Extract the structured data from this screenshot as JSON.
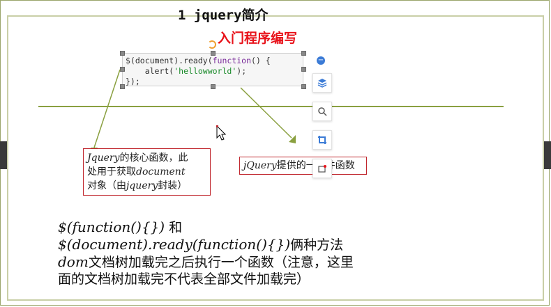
{
  "slide": {
    "title": "1 jquery简介",
    "subtitle": "入门程序编写",
    "code": {
      "line1_a": "$(document).ready(",
      "line1_kw": "function",
      "line1_b": "() {",
      "line2_a": "    alert(",
      "line2_str": "'hellowworld'",
      "line2_b": ");",
      "line3": "});"
    },
    "note1": {
      "part1": "Jquery",
      "part2": "的核心函数，此",
      "part3": "处用于获取",
      "part4": "document",
      "part5": "对象（由",
      "part6": "jquery",
      "part7": "封装）"
    },
    "note2": {
      "part1": "jQuery",
      "part2": "提供的一个件函数"
    },
    "body": {
      "l1_a": "$(function(){})",
      "l1_b": " 和",
      "l2_a": "$(document).ready(function(){})",
      "l2_b": "俩种方法",
      "l3_a": "dom",
      "l3_b": "文档树加载完之后执行一个函数（注意，这里",
      "l4": "面的文档树加载完不代表全部文件加载完）"
    }
  },
  "toolbar": {
    "icons": [
      "minus-icon",
      "layers-icon",
      "zoom-icon",
      "crop-icon",
      "resize-icon"
    ]
  },
  "colors": {
    "accent_red": "#e8121a",
    "arrow_green": "#8aa040",
    "tool_blue": "#3b7bd6"
  }
}
